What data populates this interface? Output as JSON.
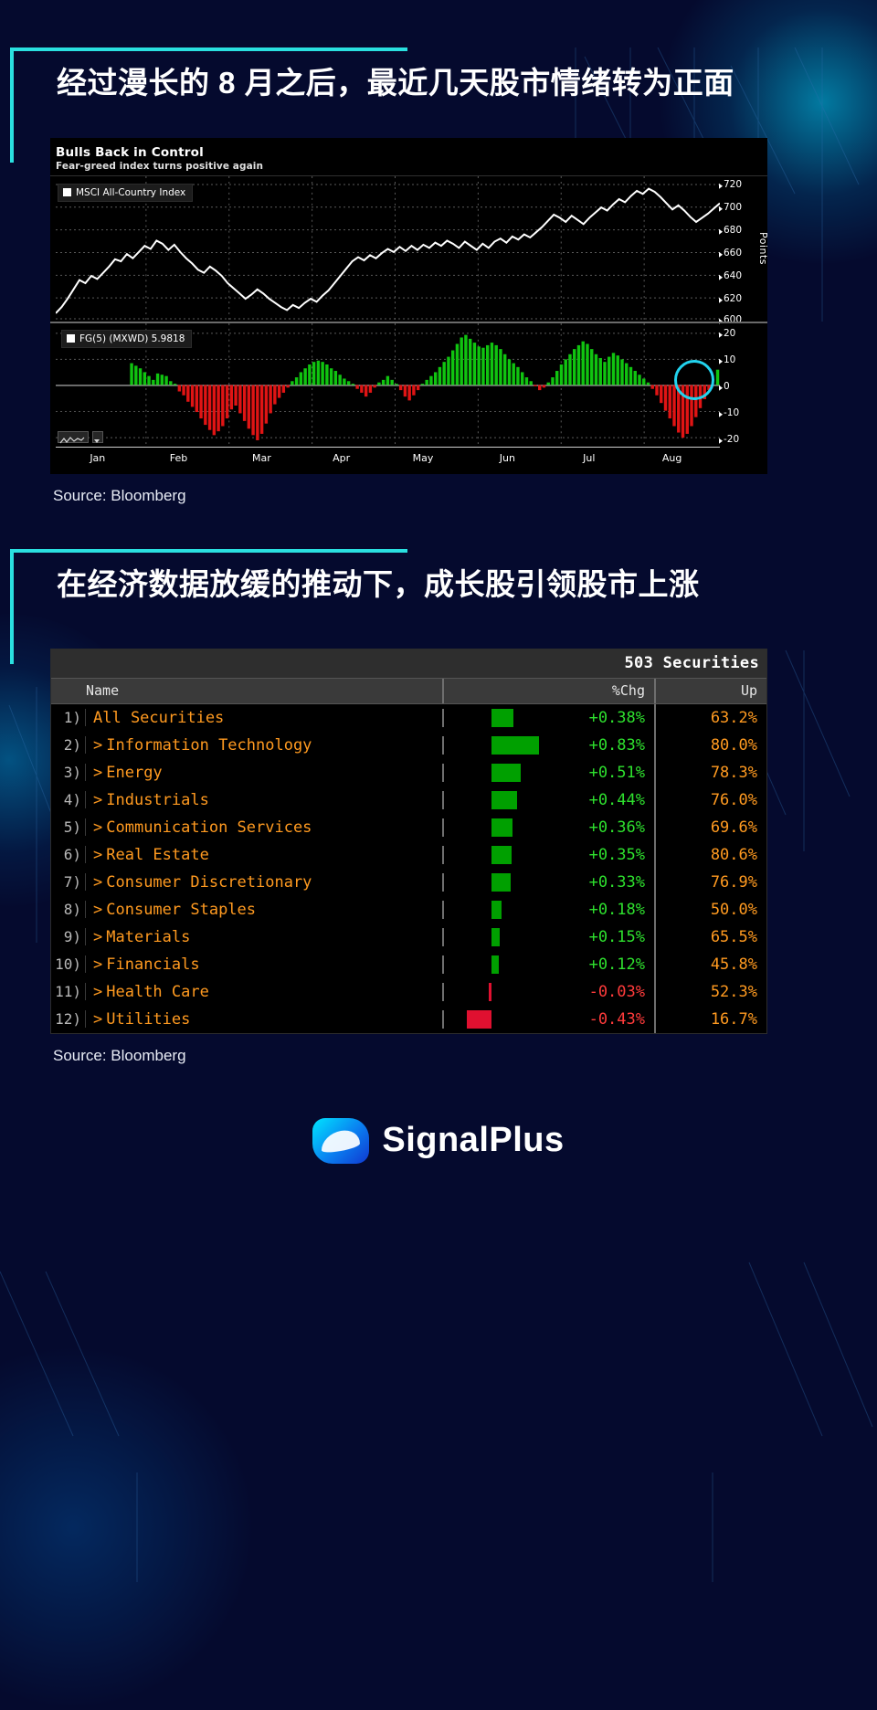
{
  "theme": {
    "background": "#050a2e",
    "accent": "#2ae0e0",
    "text": "#ffffff",
    "positive": "#2ee02e",
    "negative": "#ff3b3b",
    "row_label": "#ff9a20"
  },
  "section1": {
    "headline": "经过漫长的 8 月之后，最近几天股市情绪转为正面",
    "source": "Source: Bloomberg"
  },
  "section2": {
    "headline": "在经济数据放缓的推动下，成长股引领股市上涨",
    "source": "Source: Bloomberg"
  },
  "chart_data": {
    "type": "line",
    "title": "Bulls Back in Control",
    "subtitle": "Fear-greed index turns positive again",
    "xlabel": "",
    "tick_labels_x": [
      "Jan",
      "Feb",
      "Mar",
      "Apr",
      "May",
      "Jun",
      "Jul",
      "Aug"
    ],
    "panels": [
      {
        "name": "price-panel",
        "type": "line",
        "legend": "MSCI All-Country Index",
        "ylabel": "Points",
        "ylim": [
          590,
          730
        ],
        "ticks_y": [
          "720",
          "700",
          "680",
          "660",
          "640",
          "620",
          "600"
        ],
        "series": [
          {
            "name": "MSCI All-Country Index",
            "color": "#ffffff",
            "values": [
              598,
              604,
              612,
              621,
              630,
              627,
              634,
              631,
              637,
              643,
              650,
              648,
              655,
              651,
              657,
              663,
              660,
              668,
              665,
              659,
              664,
              657,
              651,
              646,
              640,
              637,
              643,
              639,
              634,
              627,
              622,
              617,
              612,
              616,
              621,
              617,
              612,
              608,
              604,
              601,
              606,
              603,
              608,
              612,
              609,
              615,
              620,
              627,
              634,
              641,
              648,
              652,
              649,
              654,
              651,
              656,
              660,
              657,
              662,
              658,
              663,
              659,
              664,
              661,
              666,
              663,
              668,
              665,
              661,
              667,
              663,
              659,
              665,
              661,
              667,
              670,
              666,
              672,
              669,
              674,
              671,
              676,
              681,
              687,
              693,
              690,
              686,
              692,
              688,
              684,
              690,
              695,
              700,
              697,
              703,
              708,
              705,
              711,
              716,
              713,
              718,
              715,
              710,
              704,
              698,
              702,
              697,
              691,
              686,
              690,
              694,
              699,
              704
            ]
          }
        ]
      },
      {
        "name": "fear-greed-panel",
        "type": "bar",
        "legend": "FG(5) (MXWD) 5.9818",
        "current_value": 5.9818,
        "ylim": [
          -24,
          24
        ],
        "ticks_y": [
          "20",
          "10",
          "0",
          "-10",
          "-20"
        ],
        "values": [
          0,
          0,
          0,
          0,
          0,
          0,
          0,
          0,
          0,
          0,
          0,
          0,
          0,
          0,
          0,
          0,
          0,
          8.5,
          7.5,
          6.5,
          5,
          3.5,
          2,
          4.5,
          4,
          3.5,
          1.5,
          0.5,
          -2.5,
          -4,
          -6.5,
          -8.5,
          -10.5,
          -13,
          -15.5,
          -17.5,
          -19.5,
          -18,
          -16,
          -13,
          -9.5,
          -8,
          -11,
          -14,
          -17,
          -19.5,
          -21.5,
          -19,
          -15,
          -11,
          -7.5,
          -5,
          -3,
          -1,
          1.5,
          3,
          5,
          6.5,
          8,
          9,
          9.5,
          9,
          8,
          6.5,
          5.5,
          4,
          2.5,
          1.5,
          0.5,
          -1.5,
          -3,
          -4.5,
          -3,
          -1,
          1,
          2,
          3.5,
          2,
          0.5,
          -2,
          -4.5,
          -6,
          -4,
          -2,
          0.5,
          2,
          3.5,
          5,
          7,
          9,
          11,
          13.5,
          16,
          18.5,
          19.5,
          18,
          16.5,
          15,
          14.5,
          15.5,
          16.5,
          15.5,
          14,
          12,
          10,
          8.5,
          7,
          5,
          3,
          1.5,
          -0.5,
          -2,
          -1,
          1,
          3,
          5.5,
          8,
          10,
          12,
          14,
          15.5,
          17,
          16,
          14,
          12,
          10.5,
          9,
          11,
          12.5,
          11.5,
          10,
          8.5,
          7,
          5.5,
          4,
          2.5,
          1,
          -1.5,
          -4,
          -7,
          -10,
          -13,
          -16,
          -18.5,
          -20.5,
          -19,
          -16,
          -12.5,
          -9,
          -5.5,
          -2,
          0,
          5.98
        ]
      }
    ],
    "ui": {
      "mini_toolbar": true,
      "highlight_marker": "circle-annotation-latest-bar"
    }
  },
  "table": {
    "title": "503 Securities",
    "columns": [
      "Name",
      "%Chg",
      "Up"
    ],
    "rows": [
      {
        "idx": "1)",
        "expandable": false,
        "name": "All Securities",
        "chg": "+0.38%",
        "chg_num": 0.38,
        "up": "63.2%"
      },
      {
        "idx": "2)",
        "expandable": true,
        "name": "Information Technology",
        "chg": "+0.83%",
        "chg_num": 0.83,
        "up": "80.0%"
      },
      {
        "idx": "3)",
        "expandable": true,
        "name": "Energy",
        "chg": "+0.51%",
        "chg_num": 0.51,
        "up": "78.3%"
      },
      {
        "idx": "4)",
        "expandable": true,
        "name": "Industrials",
        "chg": "+0.44%",
        "chg_num": 0.44,
        "up": "76.0%"
      },
      {
        "idx": "5)",
        "expandable": true,
        "name": "Communication Services",
        "chg": "+0.36%",
        "chg_num": 0.36,
        "up": "69.6%"
      },
      {
        "idx": "6)",
        "expandable": true,
        "name": "Real Estate",
        "chg": "+0.35%",
        "chg_num": 0.35,
        "up": "80.6%"
      },
      {
        "idx": "7)",
        "expandable": true,
        "name": "Consumer Discretionary",
        "chg": "+0.33%",
        "chg_num": 0.33,
        "up": "76.9%"
      },
      {
        "idx": "8)",
        "expandable": true,
        "name": "Consumer Staples",
        "chg": "+0.18%",
        "chg_num": 0.18,
        "up": "50.0%"
      },
      {
        "idx": "9)",
        "expandable": true,
        "name": "Materials",
        "chg": "+0.15%",
        "chg_num": 0.15,
        "up": "65.5%"
      },
      {
        "idx": "10)",
        "expandable": true,
        "name": "Financials",
        "chg": "+0.12%",
        "chg_num": 0.12,
        "up": "45.8%"
      },
      {
        "idx": "11)",
        "expandable": true,
        "name": "Health Care",
        "chg": "-0.03%",
        "chg_num": -0.03,
        "up": "52.3%"
      },
      {
        "idx": "12)",
        "expandable": true,
        "name": "Utilities",
        "chg": "-0.43%",
        "chg_num": -0.43,
        "up": "16.7%"
      }
    ]
  },
  "footer": {
    "brand": "SignalPlus"
  }
}
